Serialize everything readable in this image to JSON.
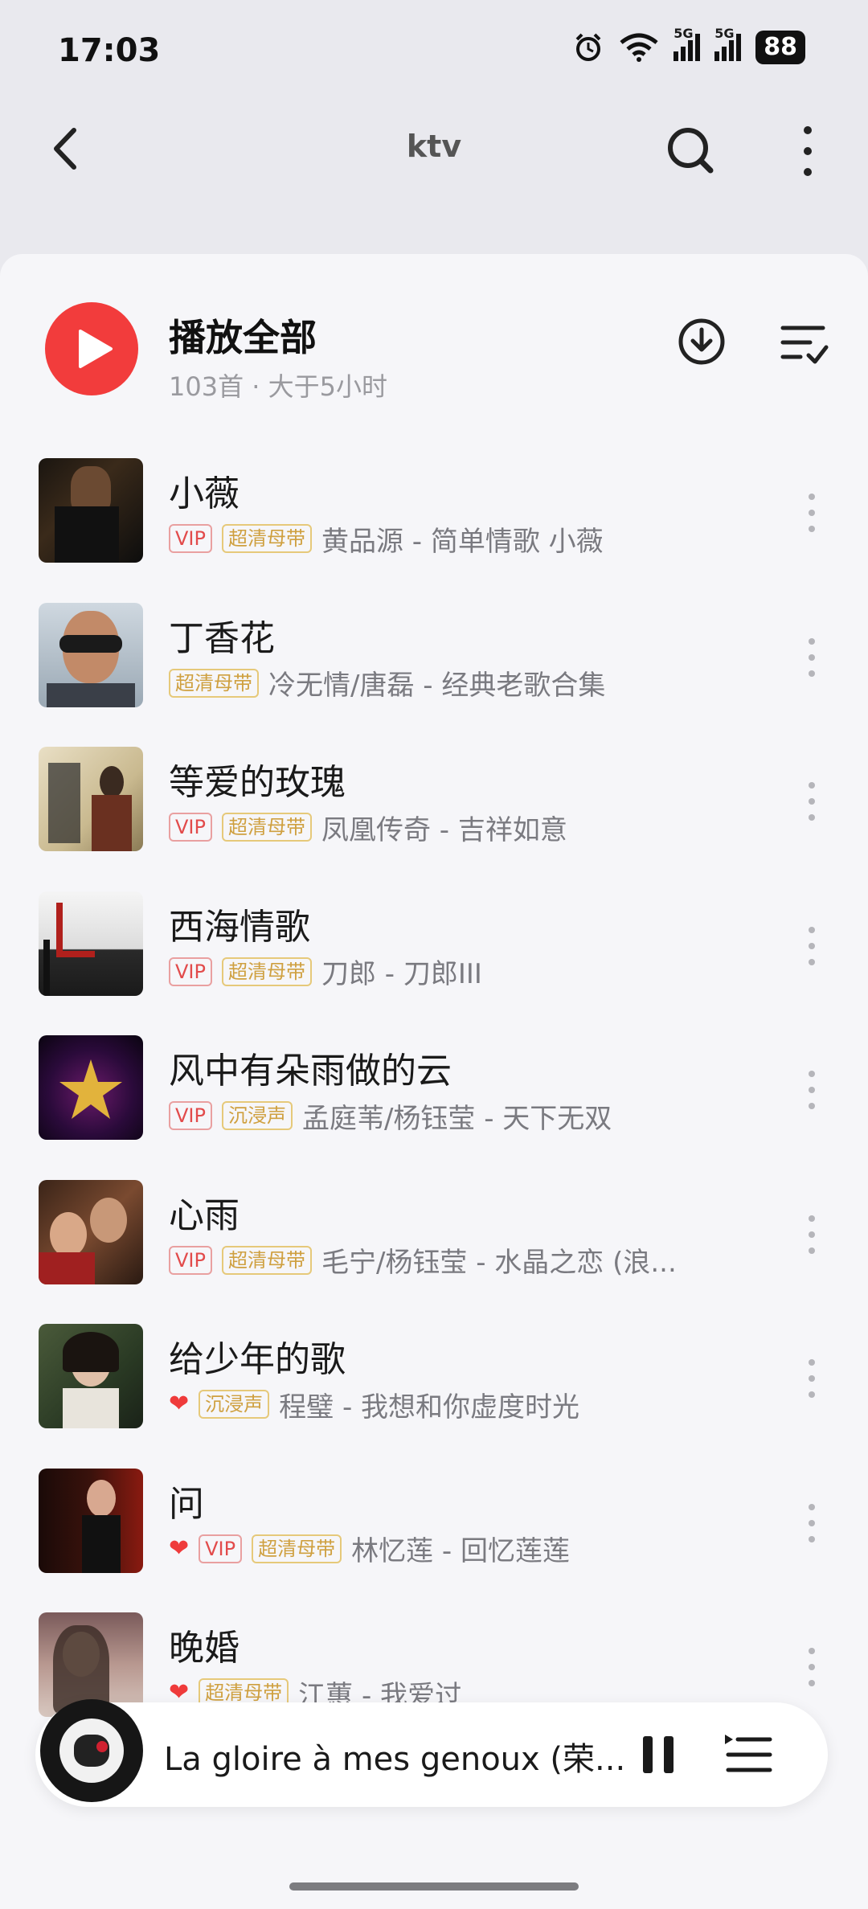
{
  "status": {
    "time": "17:03",
    "battery": "88",
    "net1": "5G",
    "net2": "5G"
  },
  "header": {
    "title": "ktv"
  },
  "play_all": {
    "title": "播放全部",
    "subtitle": "103首 · 大于5小时"
  },
  "songs": [
    {
      "title": "小薇",
      "heart": false,
      "badges": [
        "VIP",
        "超清母带"
      ],
      "meta": "黄品源 - 简单情歌 小薇"
    },
    {
      "title": "丁香花",
      "heart": false,
      "badges": [
        "超清母带"
      ],
      "meta": "冷无情/唐磊 - 经典老歌合集"
    },
    {
      "title": "等爱的玫瑰",
      "heart": false,
      "badges": [
        "VIP",
        "超清母带"
      ],
      "meta": "凤凰传奇 - 吉祥如意"
    },
    {
      "title": "西海情歌",
      "heart": false,
      "badges": [
        "VIP",
        "超清母带"
      ],
      "meta": "刀郎 - 刀郎III"
    },
    {
      "title": "风中有朵雨做的云",
      "heart": false,
      "badges": [
        "VIP",
        "沉浸声"
      ],
      "meta": "孟庭苇/杨钰莹 - 天下无双"
    },
    {
      "title": "心雨",
      "heart": false,
      "badges": [
        "VIP",
        "超清母带"
      ],
      "meta": "毛宁/杨钰莹 - 水晶之恋 (浪..."
    },
    {
      "title": "给少年的歌",
      "heart": true,
      "badges": [
        "沉浸声"
      ],
      "meta": "程璧 - 我想和你虚度时光"
    },
    {
      "title": "问",
      "heart": true,
      "badges": [
        "VIP",
        "超清母带"
      ],
      "meta": "林忆莲 - 回忆莲莲"
    },
    {
      "title": "晚婚",
      "heart": true,
      "badges": [
        "超清母带"
      ],
      "meta": "江蕙 - 我爱过"
    }
  ],
  "mini_player": {
    "title": "La gloire à mes genoux (荣..."
  },
  "colors": {
    "accent": "#f23c3c",
    "vip": "#e24b4b",
    "gold": "#cfa040"
  }
}
